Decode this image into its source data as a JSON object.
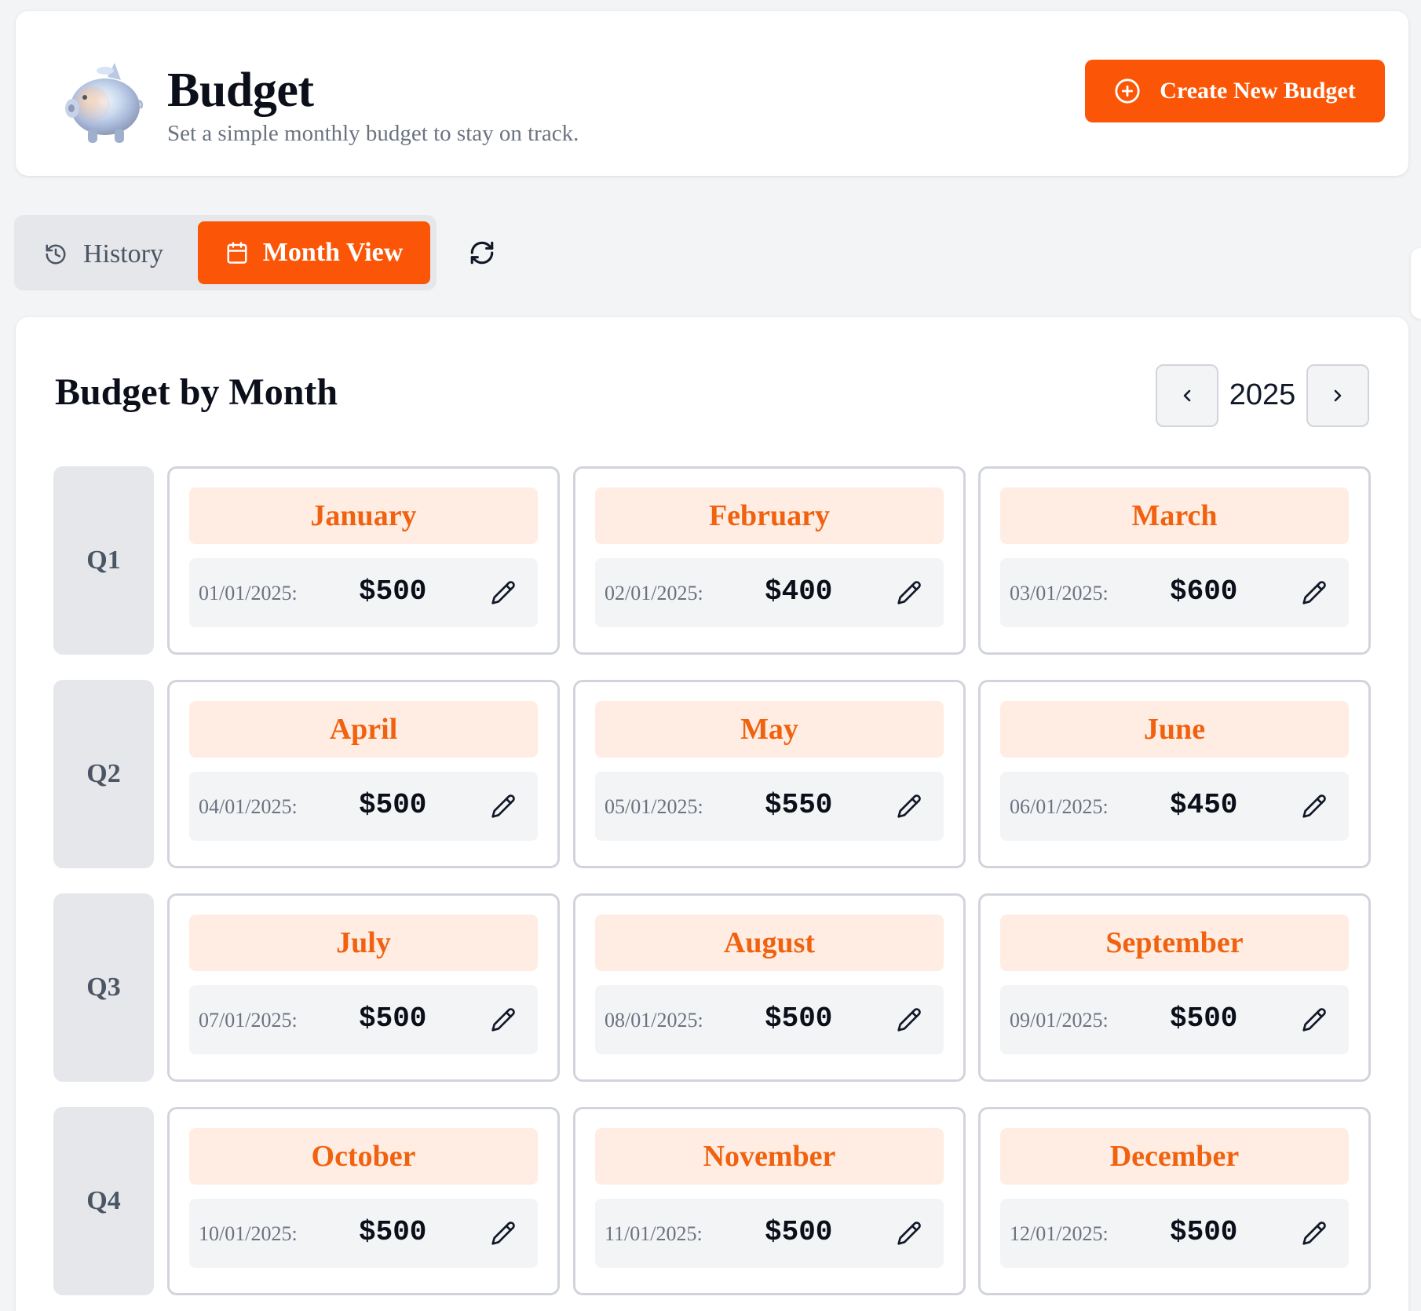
{
  "header": {
    "title": "Budget",
    "subtitle": "Set a simple monthly budget to stay on track.",
    "create_button_label": "Create New Budget",
    "accent_color": "#fb5607"
  },
  "tabs": {
    "history_label": "History",
    "month_view_label": "Month View",
    "active": "Month View"
  },
  "main": {
    "title": "Budget by Month",
    "year": "2025"
  },
  "quarters": [
    {
      "label": "Q1",
      "months": [
        {
          "name": "January",
          "date": "01/01/2025:",
          "amount": "$500"
        },
        {
          "name": "February",
          "date": "02/01/2025:",
          "amount": "$400"
        },
        {
          "name": "March",
          "date": "03/01/2025:",
          "amount": "$600"
        }
      ]
    },
    {
      "label": "Q2",
      "months": [
        {
          "name": "April",
          "date": "04/01/2025:",
          "amount": "$500"
        },
        {
          "name": "May",
          "date": "05/01/2025:",
          "amount": "$550"
        },
        {
          "name": "June",
          "date": "06/01/2025:",
          "amount": "$450"
        }
      ]
    },
    {
      "label": "Q3",
      "months": [
        {
          "name": "July",
          "date": "07/01/2025:",
          "amount": "$500"
        },
        {
          "name": "August",
          "date": "08/01/2025:",
          "amount": "$500"
        },
        {
          "name": "September",
          "date": "09/01/2025:",
          "amount": "$500"
        }
      ]
    },
    {
      "label": "Q4",
      "months": [
        {
          "name": "October",
          "date": "10/01/2025:",
          "amount": "$500"
        },
        {
          "name": "November",
          "date": "11/01/2025:",
          "amount": "$500"
        },
        {
          "name": "December",
          "date": "12/01/2025:",
          "amount": "$500"
        }
      ]
    }
  ],
  "icons": {
    "logo": "piggy-bank-icon",
    "create": "plus-circle-icon",
    "history": "history-icon",
    "month_view": "calendar-icon",
    "refresh": "refresh-icon",
    "prev": "chevron-left-icon",
    "next": "chevron-right-icon",
    "edit": "pencil-icon"
  }
}
